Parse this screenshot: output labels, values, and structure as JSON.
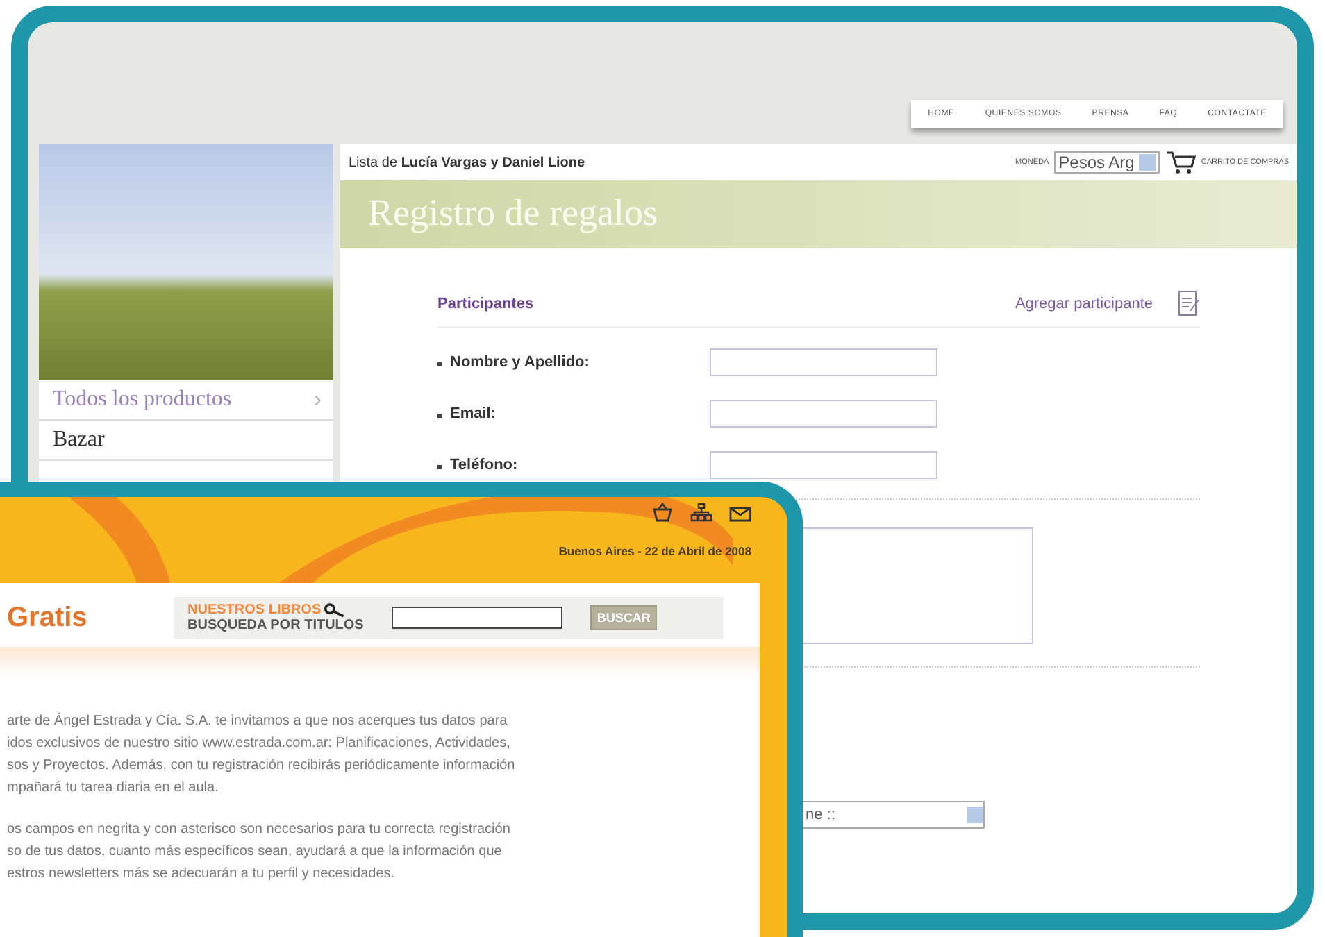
{
  "back_page": {
    "nav": [
      "HOME",
      "QUIENES SOMOS",
      "PRENSA",
      "FAQ",
      "CONTACTATE"
    ],
    "sidebar": {
      "items": [
        {
          "label": "Todos los productos",
          "selected": true
        },
        {
          "label": "Bazar",
          "selected": false
        }
      ]
    },
    "list_title": "Lista de **Lucía Vargas y Daniel Lione**",
    "currency": {
      "label": "MONEDA",
      "value": "Pesos Arg"
    },
    "cart": "CARRITO DE COMPRAS",
    "banner": "Registro de regalos",
    "section": "Participantes",
    "add_link": "Agregar participante",
    "fields": [
      {
        "label": "Nombre y Apellido:"
      },
      {
        "label": "Email:"
      },
      {
        "label": "Teléfono:"
      }
    ],
    "select_value": "ne ::"
  },
  "front_page": {
    "date": "Buenos Aires - 22 de Abril de 2008",
    "heading": "Gratis",
    "search": {
      "title": "NUESTROS LIBROS",
      "subtitle": "BUSQUEDA POR TITULOS",
      "button": "BUSCAR"
    },
    "paragraphs": [
      [
        "arte de Ángel Estrada y Cía. S.A. te invitamos a que nos acerques tus datos para",
        "idos exclusivos de nuestro sitio www.estrada.com.ar: Planificaciones, Actividades,",
        "sos y Proyectos. Además, con tu registración recibirás periódicamente información",
        "mpañará tu tarea diaria en el aula."
      ],
      [
        "os campos en negrita y con asterisco son necesarios para tu correcta registración",
        "so de tus datos, cuanto más específicos sean, ayudará a que la información que",
        "estros newsletters más se adecuarán a tu perfil y necesidades."
      ]
    ]
  }
}
